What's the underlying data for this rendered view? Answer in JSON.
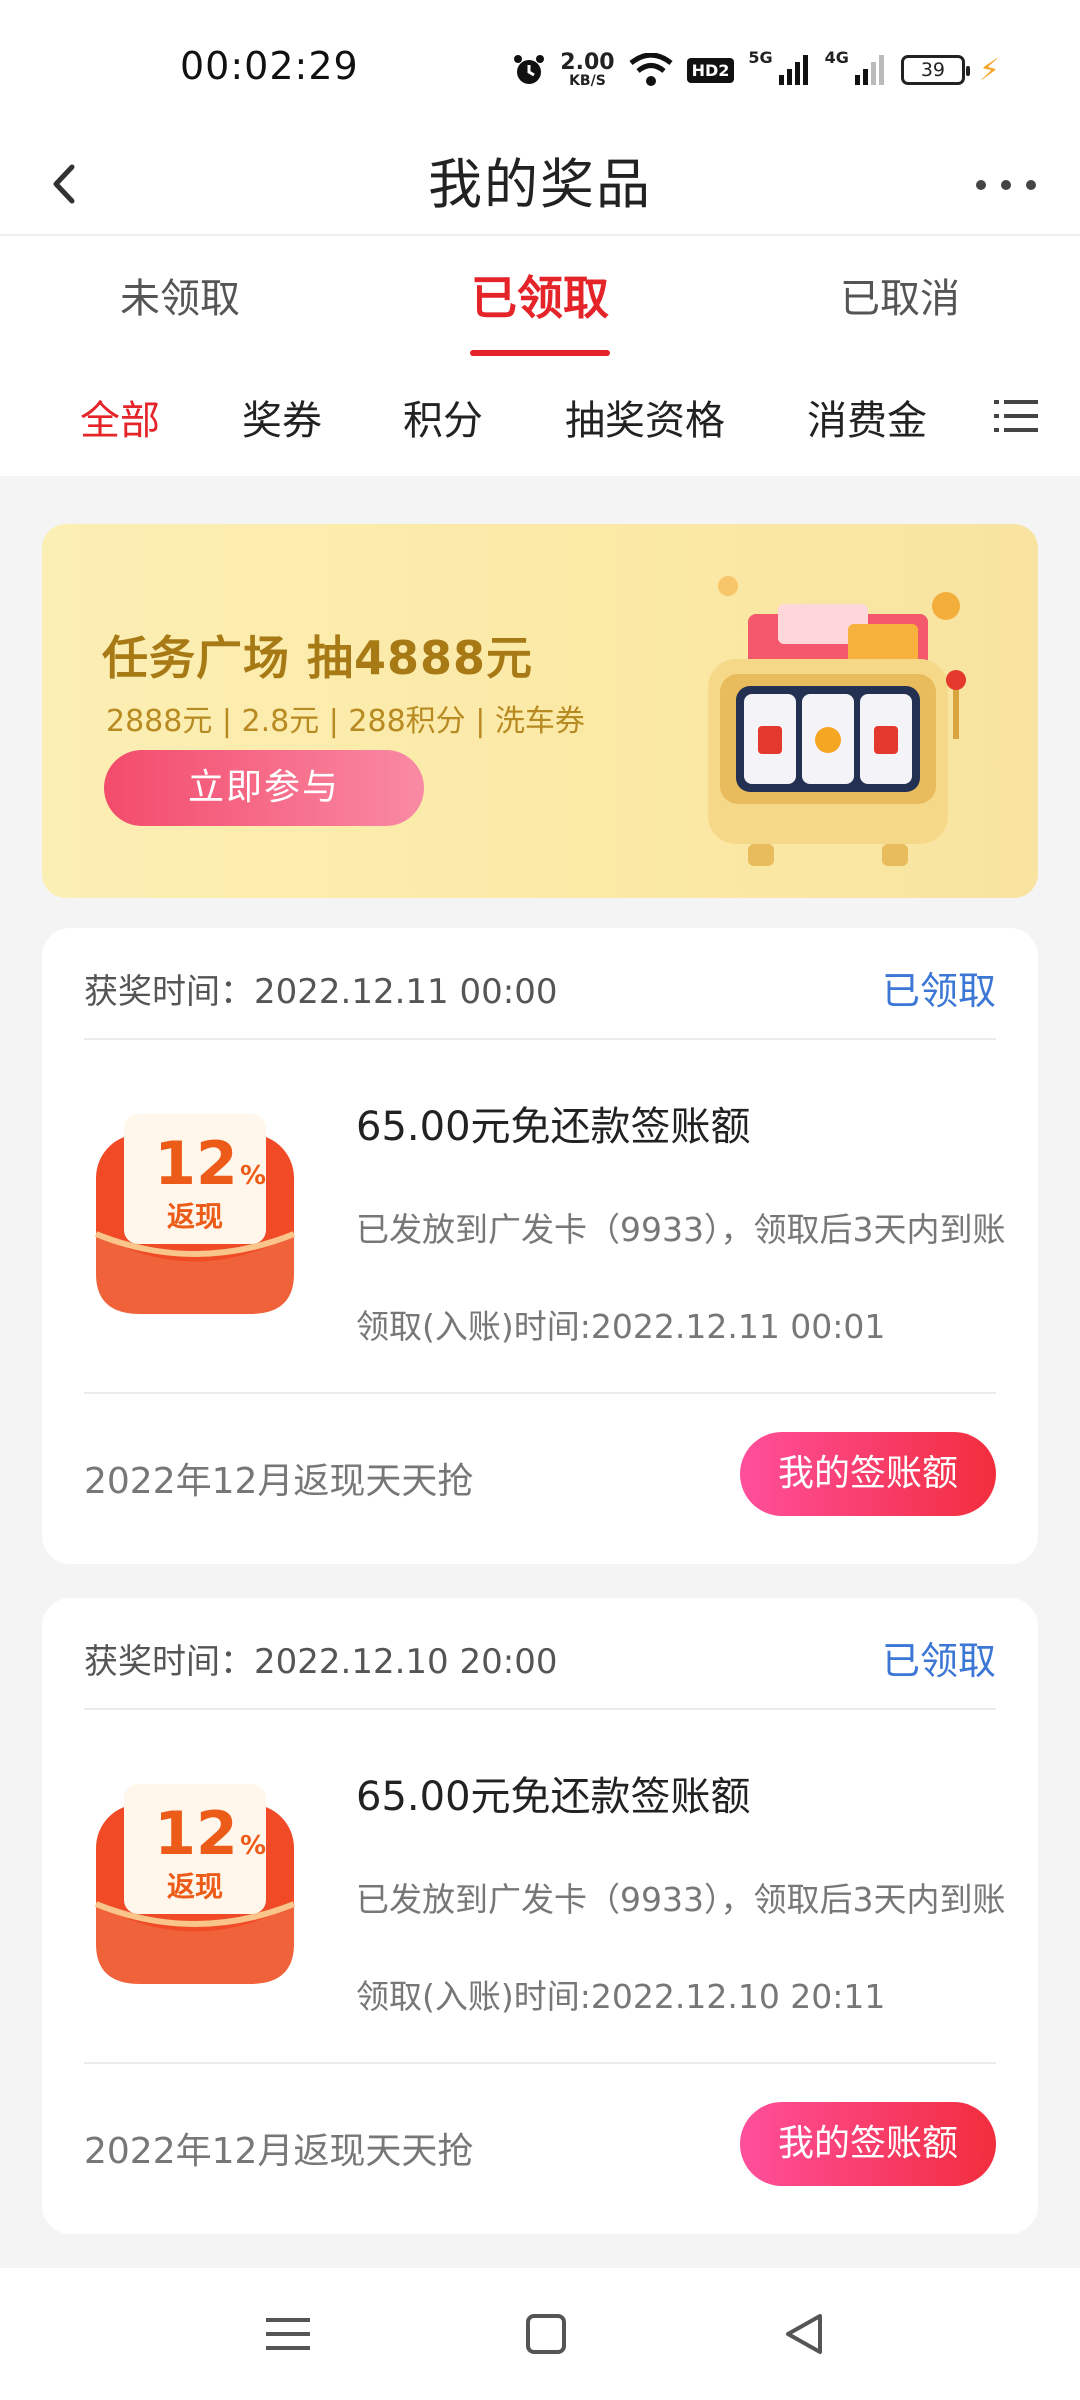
{
  "status_bar": {
    "time": "00:02:29",
    "net_speed": "2.00",
    "net_speed_unit": "KB/S",
    "hd": "HD2",
    "sig1": "5G",
    "sig2": "4G",
    "battery": "39"
  },
  "header": {
    "title": "我的奖品"
  },
  "tabs": [
    {
      "label": "未领取"
    },
    {
      "label": "已领取"
    },
    {
      "label": "已取消"
    }
  ],
  "filters": [
    {
      "label": "全部"
    },
    {
      "label": "奖券"
    },
    {
      "label": "积分"
    },
    {
      "label": "抽奖资格"
    },
    {
      "label": "消费金"
    }
  ],
  "banner": {
    "title": "任务广场 抽4888元",
    "subtitle": "2888元 | 2.8元 | 288积分 | 洗车券",
    "button": "立即参与"
  },
  "cards": [
    {
      "award_time": "获奖时间：2022.12.11 00:00",
      "status": "已领取",
      "badge_pct": "12",
      "badge_pct_sign": "%",
      "badge_text": "返现",
      "title": "65.00元免还款签账额",
      "desc": "已发放到广发卡（9933），领取后3天内到账",
      "claim_time": "领取(入账)时间:2022.12.11 00:01",
      "campaign": "2022年12月返现天天抢",
      "button": "我的签账额"
    },
    {
      "award_time": "获奖时间：2022.12.10 20:00",
      "status": "已领取",
      "badge_pct": "12",
      "badge_pct_sign": "%",
      "badge_text": "返现",
      "title": "65.00元免还款签账额",
      "desc": "已发放到广发卡（9933），领取后3天内到账",
      "claim_time": "领取(入账)时间:2022.12.10 20:11",
      "campaign": "2022年12月返现天天抢",
      "button": "我的签账额"
    }
  ],
  "icons": {
    "back": "back-arrow-icon",
    "more": "more-dots-icon",
    "list": "list-menu-icon",
    "nav_menu": "menu-icon",
    "nav_home": "home-square-icon",
    "nav_back": "back-triangle-icon"
  },
  "colors": {
    "accent": "#e5242a",
    "status_blue": "#3c77d6",
    "banner_bg": "#fcefb4",
    "banner_text": "#a87a16"
  }
}
